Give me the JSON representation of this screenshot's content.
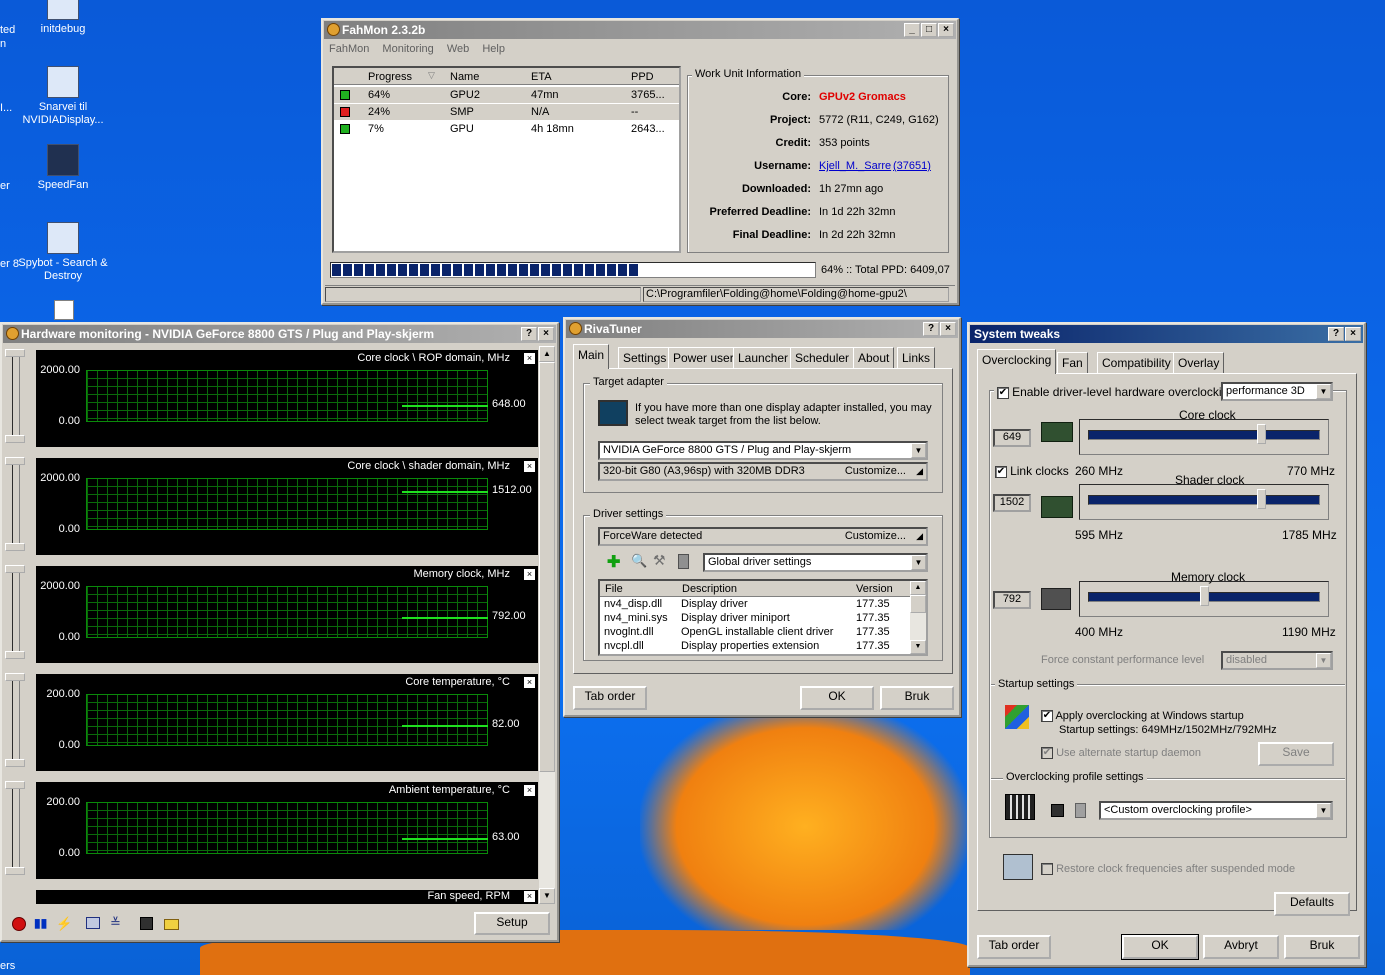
{
  "desktop": {
    "icons": [
      {
        "label": "initdebug"
      },
      {
        "label": "Snarvei til NVIDIADisplay..."
      },
      {
        "label": "SpeedFan"
      },
      {
        "label": "Spybot - Search & Destroy"
      }
    ],
    "edge_texts": [
      "ted",
      "n",
      "I...",
      "er",
      "er 8",
      "ers"
    ]
  },
  "fahmon": {
    "title": "FahMon 2.3.2b",
    "menu": [
      "FahMon",
      "Monitoring",
      "Web",
      "Help"
    ],
    "columns": [
      "Progress",
      "Name",
      "ETA",
      "PPD"
    ],
    "rows": [
      {
        "progress": "64%",
        "name": "GPU2",
        "eta": "47mn",
        "ppd": "3765...",
        "status": "green"
      },
      {
        "progress": "24%",
        "name": "SMP",
        "eta": "N/A",
        "ppd": "--",
        "status": "red"
      },
      {
        "progress": "7%",
        "name": "GPU",
        "eta": "4h 18mn",
        "ppd": "2643...",
        "status": "green"
      }
    ],
    "wu_title": "Work Unit Information",
    "wu": [
      {
        "label": "Core:",
        "value": "GPUv2 Gromacs"
      },
      {
        "label": "Project:",
        "value": "5772 (R11, C249, G162)"
      },
      {
        "label": "Credit:",
        "value": "353 points"
      },
      {
        "label": "Username:",
        "value": "Kjell_M._Sarre",
        "extra": "(37651)"
      },
      {
        "label": "Downloaded:",
        "value": "1h 27mn ago"
      },
      {
        "label": "Preferred Deadline:",
        "value": "In 1d 22h 32mn"
      },
      {
        "label": "Final Deadline:",
        "value": "In 2d 22h 32mn"
      }
    ],
    "progress_fraction": 0.64,
    "progress_text": "64% :: Total PPD: 6409,07",
    "status_path": "C:\\Programfiler\\Folding@home\\Folding@home-gpu2\\"
  },
  "hwmon": {
    "title": "Hardware monitoring - NVIDIA GeForce 8800 GTS / Plug and Play-skjerm",
    "graphs": [
      {
        "title": "Core clock \\ ROP domain, MHz",
        "max": "2000.00",
        "min": "0.00",
        "value": "648.00",
        "level": 0.324
      },
      {
        "title": "Core clock \\ shader domain, MHz",
        "max": "2000.00",
        "min": "0.00",
        "value": "1512.00",
        "level": 0.756
      },
      {
        "title": "Memory clock, MHz",
        "max": "2000.00",
        "min": "0.00",
        "value": "792.00",
        "level": 0.396
      },
      {
        "title": "Core temperature, °C",
        "max": "200.00",
        "min": "0.00",
        "value": "82.00",
        "level": 0.41
      },
      {
        "title": "Ambient temperature, °C",
        "max": "200.00",
        "min": "0.00",
        "value": "63.00",
        "level": 0.315
      }
    ],
    "partial_graph_title": "Fan speed, RPM",
    "setup_label": "Setup"
  },
  "rivatuner": {
    "title": "RivaTuner",
    "tabs": [
      "Main",
      "Settings",
      "Power user",
      "Launcher",
      "Scheduler",
      "About",
      "Links"
    ],
    "target_group": "Target adapter",
    "target_text": "If you have more than one display adapter installed, you may select tweak target from the list below.",
    "adapter": "NVIDIA GeForce 8800 GTS / Plug and Play-skjerm",
    "adapter_info": "320-bit G80 (A3,96sp) with 320MB DDR3",
    "customize": "Customize...",
    "driver_group": "Driver settings",
    "forceware": "ForceWare detected",
    "driver_select": "Global driver settings",
    "file_cols": [
      "File",
      "Description",
      "Version"
    ],
    "files": [
      {
        "file": "nv4_disp.dll",
        "desc": "Display driver",
        "ver": "177.35"
      },
      {
        "file": "nv4_mini.sys",
        "desc": "Display driver miniport",
        "ver": "177.35"
      },
      {
        "file": "nvoglnt.dll",
        "desc": "OpenGL installable client driver",
        "ver": "177.35"
      },
      {
        "file": "nvcpl.dll",
        "desc": "Display properties extension",
        "ver": "177.35"
      }
    ],
    "tab_order": "Tab order",
    "ok": "OK",
    "cancel": "Bruk"
  },
  "tweaks": {
    "title": "System tweaks",
    "tabs": [
      "Overclocking",
      "Fan",
      "Compatibility",
      "Overlay"
    ],
    "enable_label": "Enable driver-level hardware overclocking",
    "mode": "performance 3D",
    "core_label": "Core clock",
    "core_value": "649",
    "core_level": 0.76,
    "link_clocks": "Link clocks",
    "core_min": "260 MHz",
    "core_max": "770 MHz",
    "shader_label": "Shader clock",
    "shader_value": "1502",
    "shader_level": 0.76,
    "shader_min": "595 MHz",
    "shader_max": "1785 MHz",
    "mem_label": "Memory clock",
    "mem_value": "792",
    "mem_level": 0.5,
    "mem_min": "400 MHz",
    "mem_max": "1190 MHz",
    "force_label": "Force constant performance level",
    "force_value": "disabled",
    "startup_group": "Startup settings",
    "apply_label": "Apply overclocking at Windows startup",
    "startup_settings": "Startup settings: 649MHz/1502MHz/792MHz",
    "alt_daemon": "Use alternate startup daemon",
    "save": "Save",
    "profile_group": "Overclocking profile settings",
    "profile": "<Custom overclocking profile>",
    "restore_label": "Restore clock frequencies after suspended mode",
    "defaults": "Defaults",
    "tab_order": "Tab order",
    "ok": "OK",
    "cancel": "Avbryt",
    "apply": "Bruk"
  }
}
